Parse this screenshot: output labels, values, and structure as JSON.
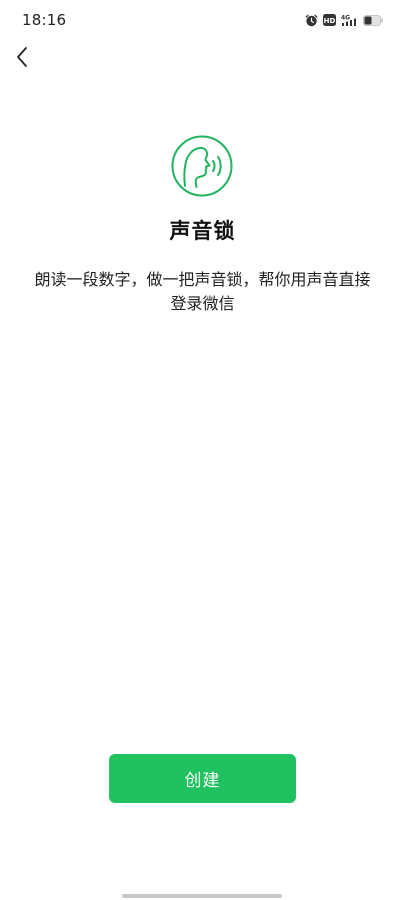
{
  "status_bar": {
    "time": "18:16",
    "icons": [
      "alarm-icon",
      "hd-icon",
      "4g-signal-icon",
      "battery-icon"
    ],
    "network_label": "4G",
    "hd_label": "HD"
  },
  "header": {
    "back_icon": "chevron-left-icon"
  },
  "main": {
    "hero_icon": "voice-face-icon",
    "title": "声音锁",
    "description": "朗读一段数字，做一把声音锁，帮你用声音直接登录微信"
  },
  "actions": {
    "create_label": "创建"
  },
  "colors": {
    "accent": "#1fc25f",
    "icon_green": "#22b35e",
    "text": "#111111",
    "background": "#ffffff"
  }
}
